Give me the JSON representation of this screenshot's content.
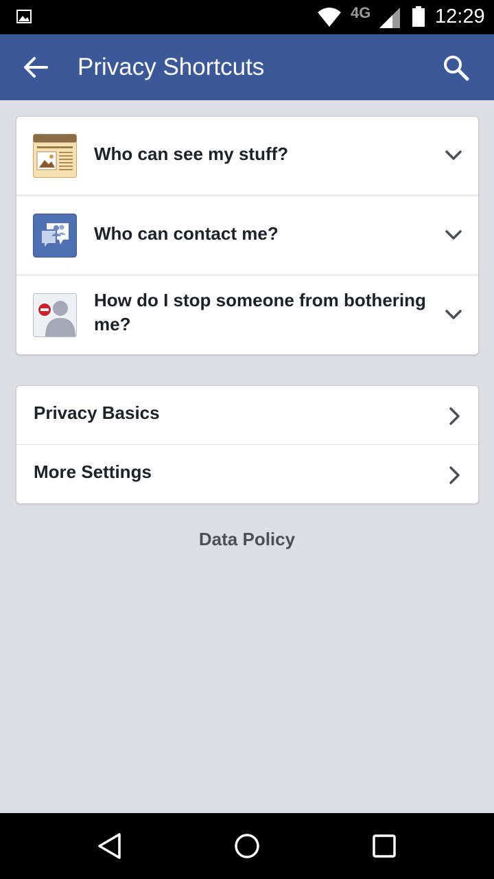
{
  "status_bar": {
    "network_type": "4G",
    "time": "12:29",
    "icons": [
      "image-notification-icon",
      "wifi-icon",
      "cell-signal-icon",
      "battery-icon"
    ]
  },
  "app_bar": {
    "title": "Privacy Shortcuts",
    "background_color": "#3b5998",
    "icons": [
      "back-arrow-icon",
      "search-icon"
    ]
  },
  "shortcuts": [
    {
      "label": "Who can see my stuff?",
      "icon": "newsfeed-icon"
    },
    {
      "label": "Who can contact me?",
      "icon": "chat-bubbles-icon"
    },
    {
      "label": "How do I stop someone from bothering me?",
      "icon": "blocked-person-icon"
    }
  ],
  "links": [
    {
      "label": "Privacy Basics"
    },
    {
      "label": "More Settings"
    }
  ],
  "footer": {
    "data_policy": "Data Policy"
  },
  "nav_bar": {
    "icons": [
      "back-triangle-icon",
      "home-circle-icon",
      "recents-square-icon"
    ]
  }
}
